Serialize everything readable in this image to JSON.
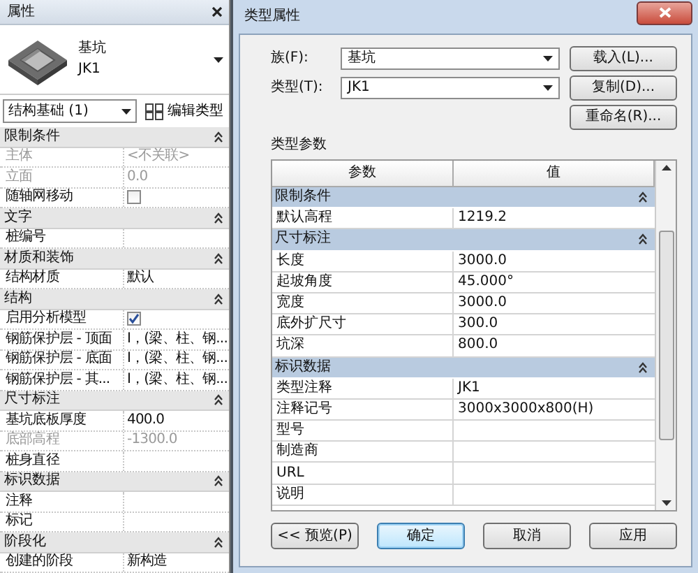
{
  "properties_panel": {
    "title": "属性",
    "type_selector": {
      "family": "基坑",
      "type": "JK1"
    },
    "filter": "结构基础 (1)",
    "edit_type_button": "编辑类型",
    "groups": [
      {
        "name": "限制条件",
        "rows": [
          {
            "label": "主体",
            "kind": "text",
            "value": "<不关联>",
            "disabled": true
          },
          {
            "label": "立面",
            "kind": "text",
            "value": "0.0",
            "disabled": true
          },
          {
            "label": "随轴网移动",
            "kind": "checkbox",
            "checked": false,
            "disabled": false
          }
        ]
      },
      {
        "name": "文字",
        "rows": [
          {
            "label": "桩编号",
            "kind": "text",
            "disabled": false
          }
        ]
      },
      {
        "name": "材质和装饰",
        "rows": [
          {
            "label": "结构材质",
            "kind": "text",
            "value": "默认",
            "disabled": false
          }
        ]
      },
      {
        "name": "结构",
        "rows": [
          {
            "label": "启用分析模型",
            "kind": "checkbox",
            "checked": true,
            "disabled": false
          },
          {
            "label": "钢筋保护层 - 顶面",
            "kind": "text",
            "value": "I，(梁、柱、钢...",
            "disabled": false
          },
          {
            "label": "钢筋保护层 - 底面",
            "kind": "text",
            "value": "I，(梁、柱、钢...",
            "disabled": false
          },
          {
            "label": "钢筋保护层 - 其...",
            "kind": "text",
            "value": "I，(梁、柱、钢...",
            "disabled": false
          }
        ]
      },
      {
        "name": "尺寸标注",
        "rows": [
          {
            "label": "基坑底板厚度",
            "kind": "text",
            "value": "400.0",
            "disabled": false
          },
          {
            "label": "底部高程",
            "kind": "text",
            "value": "-1300.0",
            "disabled": true
          },
          {
            "label": "桩身直径",
            "kind": "text",
            "disabled": false
          }
        ]
      },
      {
        "name": "标识数据",
        "rows": [
          {
            "label": "注释",
            "kind": "text",
            "disabled": false
          },
          {
            "label": "标记",
            "kind": "text",
            "disabled": false
          }
        ]
      },
      {
        "name": "阶段化",
        "rows": [
          {
            "label": "创建的阶段",
            "kind": "text",
            "value": "新构造",
            "disabled": false
          }
        ]
      }
    ]
  },
  "type_dialog": {
    "title": "类型属性",
    "family_label": "族(F):",
    "family": "基坑",
    "type_label": "类型(T):",
    "type": "JK1",
    "side_buttons": [
      "载入(L)...",
      "复制(D)...",
      "重命名(R)..."
    ],
    "params_label": "类型参数",
    "columns": [
      "参数",
      "值"
    ],
    "groups": [
      {
        "name": "限制条件",
        "rows": [
          {
            "label": "默认高程",
            "value": "1219.2"
          }
        ]
      },
      {
        "name": "尺寸标注",
        "rows": [
          {
            "label": "长度",
            "value": "3000.0"
          },
          {
            "label": "起坡角度",
            "value": "45.000°"
          },
          {
            "label": "宽度",
            "value": "3000.0"
          },
          {
            "label": "底外扩尺寸",
            "value": "300.0"
          },
          {
            "label": "坑深",
            "value": "800.0"
          }
        ]
      },
      {
        "name": "标识数据",
        "rows": [
          {
            "label": "类型注释",
            "value": "JK1"
          },
          {
            "label": "注释记号",
            "value": "3000x3000x800(H)"
          },
          {
            "label": "型号"
          },
          {
            "label": "制造商"
          },
          {
            "label": "URL"
          },
          {
            "label": "说明"
          }
        ]
      }
    ],
    "footer_buttons": [
      {
        "label": "<< 预览(P)",
        "default": false
      },
      {
        "label": "确定",
        "default": true
      },
      {
        "label": "取消",
        "default": false
      },
      {
        "label": "应用",
        "default": false
      }
    ]
  }
}
